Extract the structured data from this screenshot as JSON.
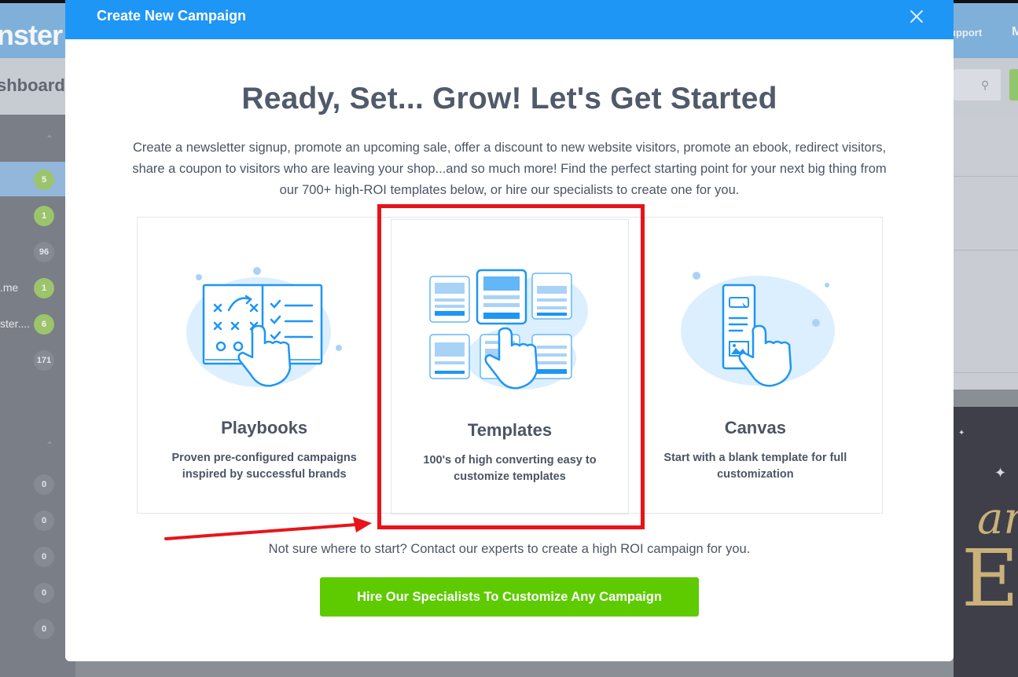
{
  "background_app": {
    "logo_fragment": "nster",
    "support_fragment": "upport",
    "menu_fragment": "M",
    "page_title_fragment": "shboard",
    "sidebar_badges": [
      {
        "label": "",
        "count": "5",
        "style": "green",
        "active": true
      },
      {
        "label": "",
        "count": "1",
        "style": "green",
        "active": false
      },
      {
        "label": "",
        "count": "96",
        "style": "gray",
        "active": false
      },
      {
        "label": ".me",
        "count": "1",
        "style": "green",
        "active": false
      },
      {
        "label": "ster....",
        "count": "6",
        "style": "green",
        "active": false
      },
      {
        "label": "",
        "count": "171",
        "style": "gray",
        "active": false
      }
    ],
    "sidebar_zero_badges": [
      "0",
      "0",
      "0",
      "0",
      "0"
    ]
  },
  "modal": {
    "title": "Create New Campaign",
    "close_icon": "close-icon",
    "headline": "Ready, Set... Grow! Let's Get Started",
    "intro": "Create a newsletter signup, promote an upcoming sale, offer a discount to new website visitors, promote an ebook, redirect visitors, share a coupon to visitors who are leaving your shop...and so much more! Find the perfect starting point for your next big thing from our 700+ high-ROI templates below, or hire our specialists to create one for you.",
    "cards": [
      {
        "title": "Playbooks",
        "description": "Proven pre-configured campaigns inspired by successful brands",
        "icon": "playbook-hand-icon"
      },
      {
        "title": "Templates",
        "description": "100's of high converting easy to customize templates",
        "icon": "templates-grid-hand-icon"
      },
      {
        "title": "Canvas",
        "description": "Start with a blank template for full customization",
        "icon": "canvas-phone-hand-icon"
      }
    ],
    "footer_note": "Not sure where to start? Contact our experts to create a high ROI campaign for you.",
    "cta_label": "Hire Our Specialists To Customize Any Campaign"
  },
  "colors": {
    "header_blue": "#1e96f5",
    "cta_green": "#5ecb00",
    "annotation_red": "#e8141a",
    "text_dark": "#4c5564"
  }
}
